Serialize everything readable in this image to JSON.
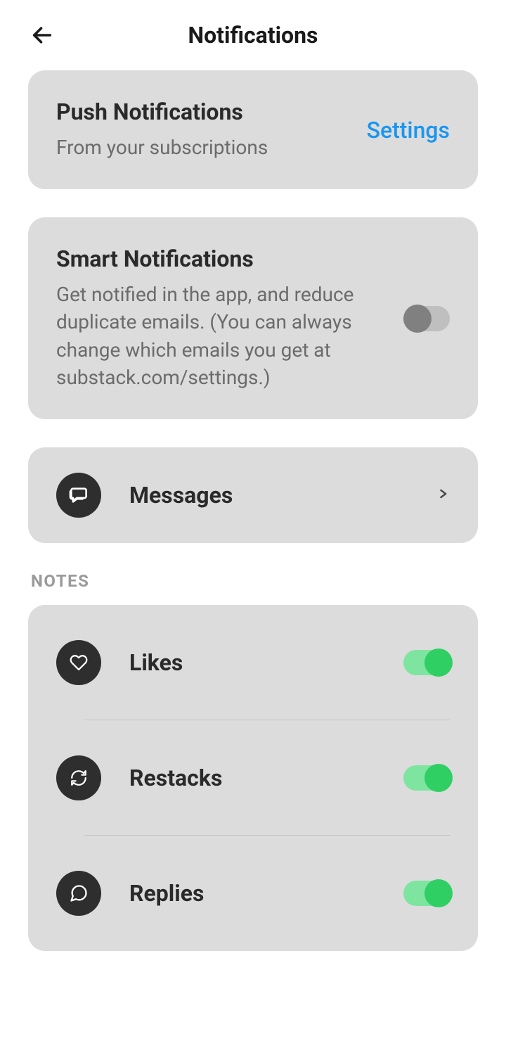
{
  "header": {
    "title": "Notifications"
  },
  "push": {
    "title": "Push Notifications",
    "subtitle": "From your subscriptions",
    "action": "Settings"
  },
  "smart": {
    "title": "Smart Notifications",
    "subtitle": "Get notified in the app, and reduce duplicate emails. (You can always change which emails you get at substack.com/settings.)",
    "enabled": false
  },
  "messages": {
    "label": "Messages"
  },
  "sections": {
    "notes": {
      "label": "Notes",
      "items": [
        {
          "key": "likes",
          "label": "Likes",
          "enabled": true
        },
        {
          "key": "restacks",
          "label": "Restacks",
          "enabled": true
        },
        {
          "key": "replies",
          "label": "Replies",
          "enabled": true
        }
      ]
    }
  }
}
